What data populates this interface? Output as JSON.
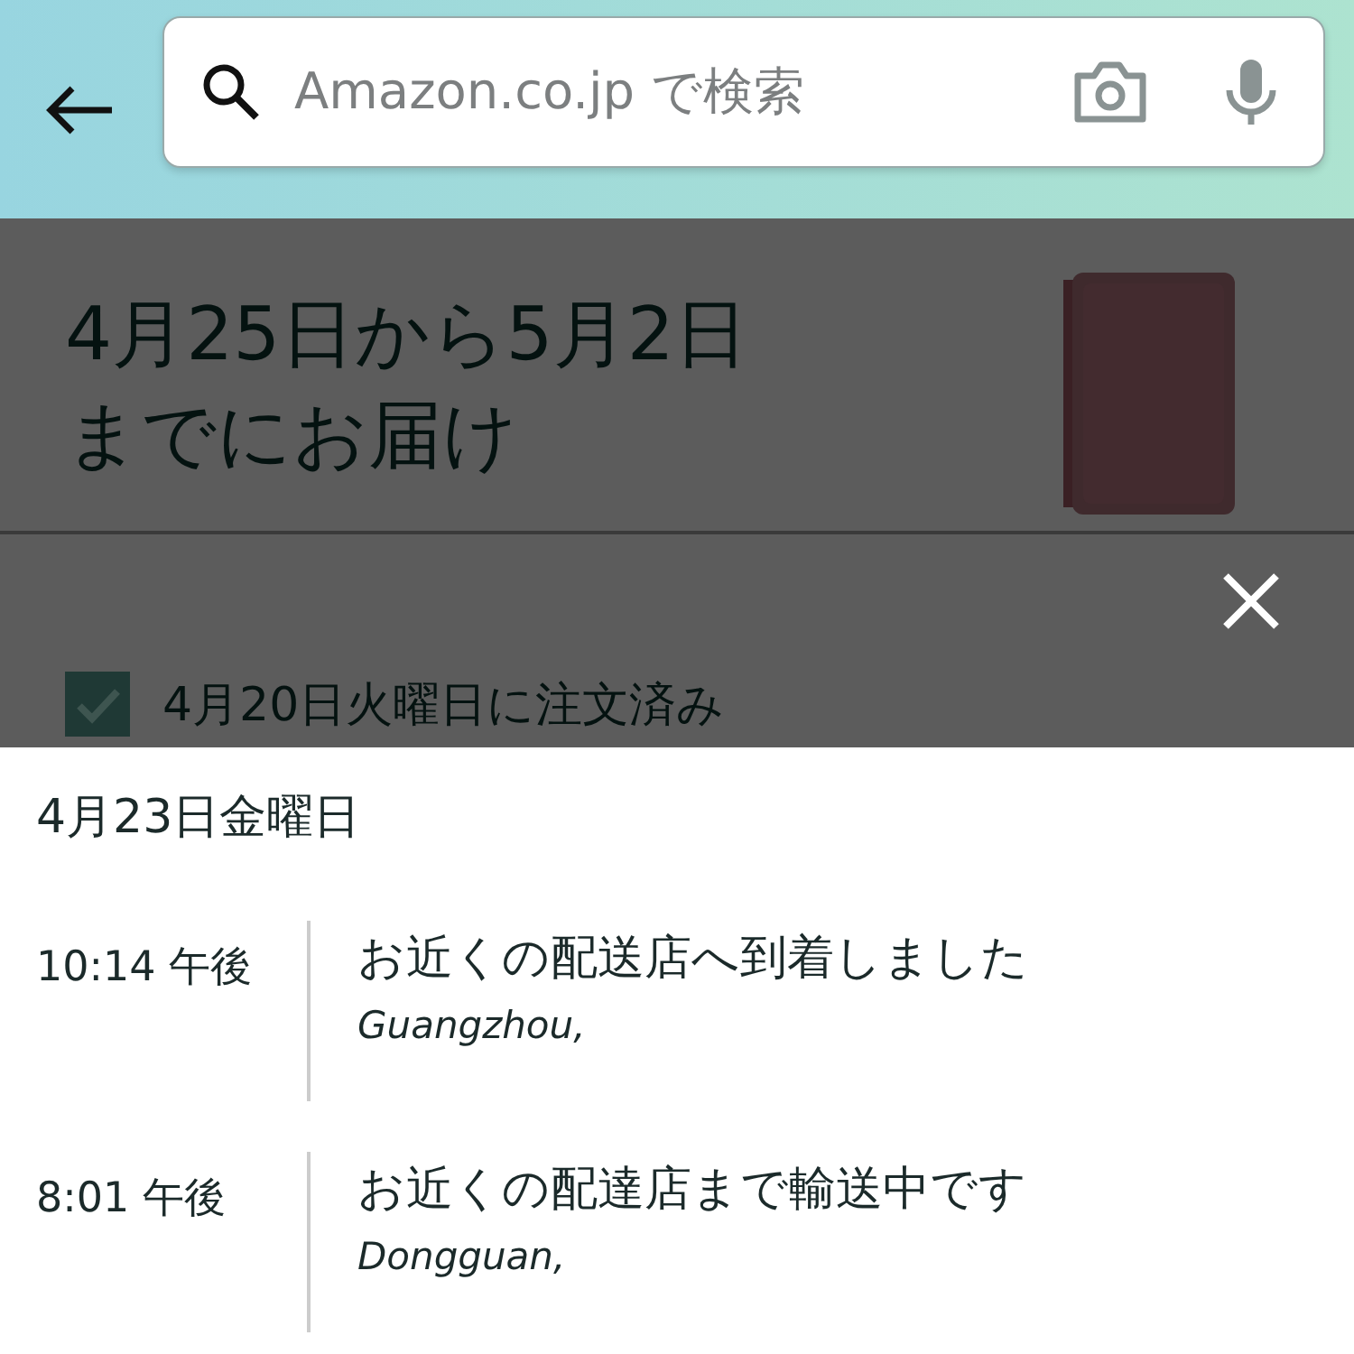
{
  "search": {
    "placeholder": "Amazon.co.jp で検索"
  },
  "delivery": {
    "headline": "4月25日から5月2日までにお届け"
  },
  "ordered_step": {
    "label": "4月20日火曜日に注文済み",
    "checked": true
  },
  "tracking": {
    "date": "4月23日金曜日",
    "events": [
      {
        "time": "10:14",
        "period": "午後",
        "status": "お近くの配送店へ到着しました",
        "location": "Guangzhou,"
      },
      {
        "time": "8:01",
        "period": "午後",
        "status": "お近くの配達店まで輸送中です",
        "location": "Dongguan,"
      }
    ]
  }
}
